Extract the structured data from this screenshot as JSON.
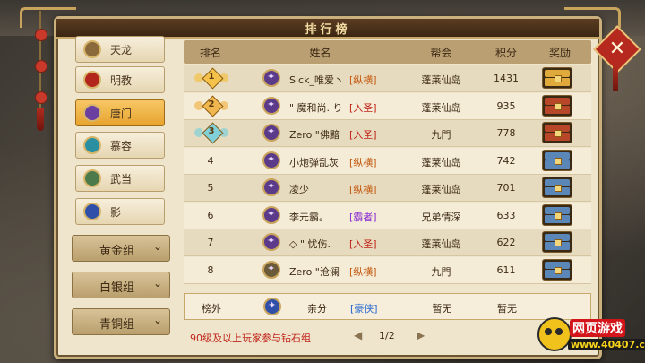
{
  "panel": {
    "title": "排行榜"
  },
  "sidebar": {
    "schools": [
      {
        "label": "天龙",
        "icon": "tianlong-emblem-icon",
        "color": "#8a6a3a",
        "active": false
      },
      {
        "label": "明教",
        "icon": "mingjiao-emblem-icon",
        "color": "#b2261c",
        "active": false
      },
      {
        "label": "唐门",
        "icon": "tangmen-emblem-icon",
        "color": "#6b3fa0",
        "active": true
      },
      {
        "label": "慕容",
        "icon": "murong-emblem-icon",
        "color": "#2a8fa0",
        "active": false
      },
      {
        "label": "武当",
        "icon": "wudang-emblem-icon",
        "color": "#4d7a4a",
        "active": false
      },
      {
        "label": "影",
        "icon": "ying-emblem-icon",
        "color": "#2f4fa8",
        "active": false
      }
    ],
    "groups": [
      {
        "label": "黄金组"
      },
      {
        "label": "白银组"
      },
      {
        "label": "青铜组"
      }
    ]
  },
  "table": {
    "headers": {
      "rank": "排名",
      "name": "姓名",
      "guild": "帮会",
      "score": "积分",
      "reward": "奖励"
    },
    "rows": [
      {
        "rank": "1",
        "badge": "gold",
        "name": "Sick_唯爱丶",
        "tag": "[纵横]",
        "tag_color": "#c35a12",
        "guild": "蓬莱仙岛",
        "score": "1431",
        "chest": "gold",
        "avatar": "#5b3a8a"
      },
      {
        "rank": "2",
        "badge": "silver",
        "name": "\" 魔和尚. り",
        "tag": "[入圣]",
        "tag_color": "#c0241a",
        "guild": "蓬莱仙岛",
        "score": "935",
        "chest": "red",
        "avatar": "#5b3a8a"
      },
      {
        "rank": "3",
        "badge": "bronze",
        "name": "Zero \"佛黯",
        "tag": "[入圣]",
        "tag_color": "#c0241a",
        "guild": "九門",
        "score": "778",
        "chest": "red",
        "avatar": "#5b3a8a"
      },
      {
        "rank": "4",
        "badge": "",
        "name": "小炮弹乱灰",
        "tag": "[纵横]",
        "tag_color": "#c35a12",
        "guild": "蓬莱仙岛",
        "score": "742",
        "chest": "blue",
        "avatar": "#5b3a8a"
      },
      {
        "rank": "5",
        "badge": "",
        "name": "凌少",
        "tag": "[纵横]",
        "tag_color": "#c35a12",
        "guild": "蓬莱仙岛",
        "score": "701",
        "chest": "blue",
        "avatar": "#5b3a8a"
      },
      {
        "rank": "6",
        "badge": "",
        "name": "李元霸。",
        "tag": "[霸者]",
        "tag_color": "#8a2bd0",
        "guild": "兄弟情深",
        "score": "633",
        "chest": "blue",
        "avatar": "#5b3a8a"
      },
      {
        "rank": "7",
        "badge": "",
        "name": "◇ \" 忧伤.",
        "tag": "[入圣]",
        "tag_color": "#c0241a",
        "guild": "蓬莱仙岛",
        "score": "622",
        "chest": "blue",
        "avatar": "#5b3a8a"
      },
      {
        "rank": "8",
        "badge": "",
        "name": "Zero \"沧澜",
        "tag": "[纵横]",
        "tag_color": "#c35a12",
        "guild": "九門",
        "score": "611",
        "chest": "blue",
        "avatar": "#6a5a3a"
      }
    ],
    "self_row": {
      "rank": "榜外",
      "name": "亲分",
      "tag": "[豪侠]",
      "tag_color": "#2a6ad0",
      "guild": "暂无",
      "score": "暂无",
      "avatar": "#2f4fa8"
    }
  },
  "footer": {
    "hint": "90级及以上玩家参与钻石组",
    "page": "1/2"
  },
  "watermark": {
    "line1": "网页游戏",
    "line2": "www.40407.com"
  },
  "colors": {
    "badge_gold": "#f4c24a",
    "badge_silver": "#f0b650",
    "badge_bronze": "#7fd0d8",
    "chest_gold": "#e0a93c",
    "chest_red": "#b8472a",
    "chest_blue": "#5a86b8"
  }
}
